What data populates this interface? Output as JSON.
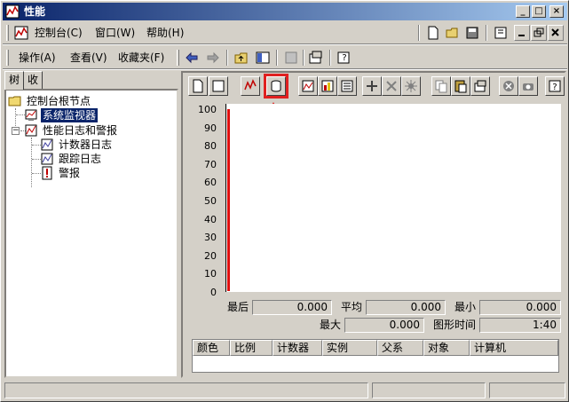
{
  "window": {
    "title": "性能"
  },
  "menubar": {
    "items": [
      {
        "label": "控制台(C)"
      },
      {
        "label": "窗口(W)"
      },
      {
        "label": "帮助(H)"
      }
    ]
  },
  "actionbar": {
    "items": [
      {
        "label": "操作(A)"
      },
      {
        "label": "查看(V)"
      },
      {
        "label": "收藏夹(F)"
      }
    ]
  },
  "left_tabs": [
    {
      "label": "树"
    },
    {
      "label": "收藏夹"
    }
  ],
  "tree": {
    "root": "控制台根节点",
    "items": [
      {
        "label": "系统监视器"
      },
      {
        "label": "性能日志和警报"
      },
      {
        "label": "计数器日志"
      },
      {
        "label": "跟踪日志"
      },
      {
        "label": "警报"
      }
    ]
  },
  "graph": {
    "y_ticks": [
      "100",
      "90",
      "80",
      "70",
      "60",
      "50",
      "40",
      "30",
      "20",
      "10",
      "0"
    ]
  },
  "stats": {
    "last_label": "最后",
    "last_value": "0.000",
    "avg_label": "平均",
    "avg_value": "0.000",
    "min_label": "最小",
    "min_value": "0.000",
    "max_label": "最大",
    "max_value": "0.000",
    "duration_label": "图形时间",
    "duration_value": "1:40"
  },
  "legend": {
    "columns": [
      "颜色",
      "比例",
      "计数器",
      "实例",
      "父系",
      "对象",
      "计算机"
    ]
  },
  "colors": {
    "title_bar": "#0a246a",
    "selection": "#0a246a",
    "graph_line": "#e01010",
    "annotation": "#e02020"
  }
}
